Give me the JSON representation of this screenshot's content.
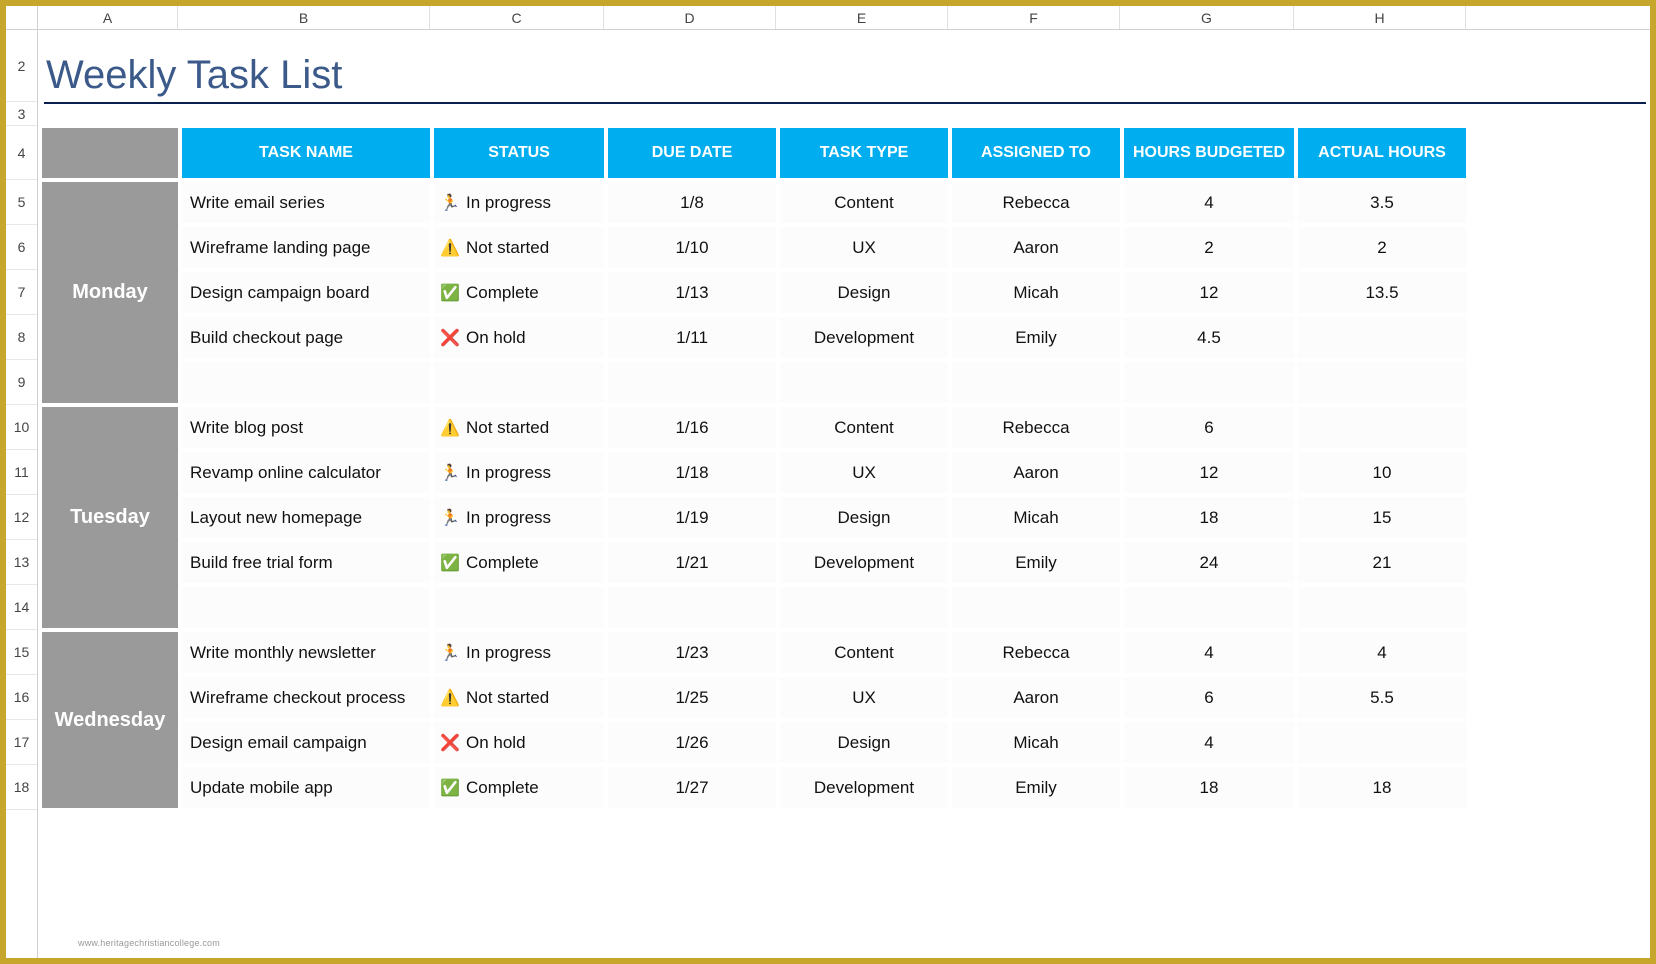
{
  "columns": [
    "A",
    "B",
    "C",
    "D",
    "E",
    "F",
    "G",
    "H"
  ],
  "rowNumbers": [
    "2",
    "3",
    "4",
    "5",
    "6",
    "7",
    "8",
    "9",
    "10",
    "11",
    "12",
    "13",
    "14",
    "15",
    "16",
    "17",
    "18"
  ],
  "title": "Weekly Task List",
  "headers": {
    "taskName": "TASK NAME",
    "status": "STATUS",
    "dueDate": "DUE DATE",
    "taskType": "TASK TYPE",
    "assignedTo": "ASSIGNED TO",
    "hoursBudgeted": "HOURS BUDGETED",
    "actualHours": "ACTUAL HOURS"
  },
  "statusLabels": {
    "inProgress": "In progress",
    "notStarted": "Not started",
    "complete": "Complete",
    "onHold": "On hold"
  },
  "groups": [
    {
      "day": "Monday",
      "rows": [
        {
          "task": "Write email series",
          "status": "inProgress",
          "due": "1/8",
          "type": "Content",
          "assigned": "Rebecca",
          "budget": "4",
          "actual": "3.5"
        },
        {
          "task": "Wireframe landing page",
          "status": "notStarted",
          "due": "1/10",
          "type": "UX",
          "assigned": "Aaron",
          "budget": "2",
          "actual": "2"
        },
        {
          "task": "Design campaign board",
          "status": "complete",
          "due": "1/13",
          "type": "Design",
          "assigned": "Micah",
          "budget": "12",
          "actual": "13.5"
        },
        {
          "task": "Build checkout page",
          "status": "onHold",
          "due": "1/11",
          "type": "Development",
          "assigned": "Emily",
          "budget": "4.5",
          "actual": ""
        },
        {
          "task": "",
          "status": "",
          "due": "",
          "type": "",
          "assigned": "",
          "budget": "",
          "actual": ""
        }
      ]
    },
    {
      "day": "Tuesday",
      "rows": [
        {
          "task": "Write blog post",
          "status": "notStarted",
          "due": "1/16",
          "type": "Content",
          "assigned": "Rebecca",
          "budget": "6",
          "actual": ""
        },
        {
          "task": "Revamp online calculator",
          "status": "inProgress",
          "due": "1/18",
          "type": "UX",
          "assigned": "Aaron",
          "budget": "12",
          "actual": "10"
        },
        {
          "task": "Layout new homepage",
          "status": "inProgress",
          "due": "1/19",
          "type": "Design",
          "assigned": "Micah",
          "budget": "18",
          "actual": "15"
        },
        {
          "task": "Build free trial form",
          "status": "complete",
          "due": "1/21",
          "type": "Development",
          "assigned": "Emily",
          "budget": "24",
          "actual": "21"
        },
        {
          "task": "",
          "status": "",
          "due": "",
          "type": "",
          "assigned": "",
          "budget": "",
          "actual": ""
        }
      ]
    },
    {
      "day": "Wednesday",
      "rows": [
        {
          "task": "Write monthly newsletter",
          "status": "inProgress",
          "due": "1/23",
          "type": "Content",
          "assigned": "Rebecca",
          "budget": "4",
          "actual": "4"
        },
        {
          "task": "Wireframe checkout process",
          "status": "notStarted",
          "due": "1/25",
          "type": "UX",
          "assigned": "Aaron",
          "budget": "6",
          "actual": "5.5"
        },
        {
          "task": "Design email campaign",
          "status": "onHold",
          "due": "1/26",
          "type": "Design",
          "assigned": "Micah",
          "budget": "4",
          "actual": ""
        },
        {
          "task": "Update mobile app",
          "status": "complete",
          "due": "1/27",
          "type": "Development",
          "assigned": "Emily",
          "budget": "18",
          "actual": "18"
        }
      ]
    }
  ],
  "watermark": "www.heritagechristiancollege.com"
}
